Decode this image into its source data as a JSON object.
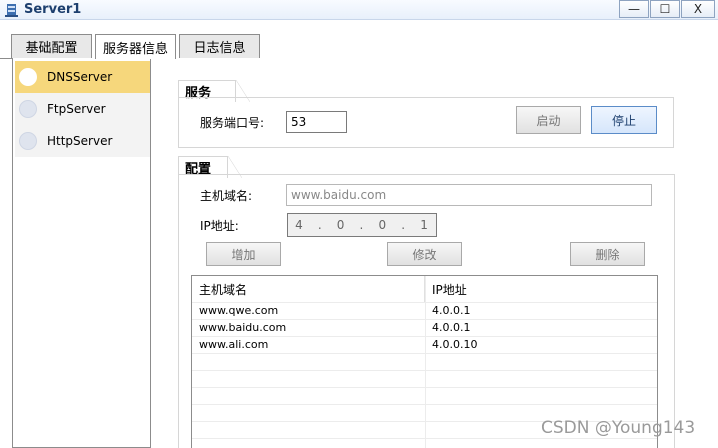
{
  "window": {
    "title": "Server1",
    "minimize_glyph": "—",
    "maximize_glyph": "☐",
    "close_glyph": "X"
  },
  "tabs": [
    {
      "label": "基础配置",
      "active": false
    },
    {
      "label": "服务器信息",
      "active": true
    },
    {
      "label": "日志信息",
      "active": false
    }
  ],
  "servers": [
    {
      "label": "DNSServer",
      "selected": true
    },
    {
      "label": "FtpServer",
      "selected": false
    },
    {
      "label": "HttpServer",
      "selected": false
    }
  ],
  "service": {
    "group_label": "服务",
    "port_label": "服务端口号:",
    "port_value": "53",
    "start_label": "启动",
    "stop_label": "停止"
  },
  "config": {
    "group_label": "配置",
    "domain_label": "主机域名:",
    "domain_placeholder": "www.baidu.com",
    "ip_label": "IP地址:",
    "ip_octets": [
      "4",
      "0",
      "0",
      "1"
    ],
    "ip_dot": ".",
    "add_label": "增加",
    "modify_label": "修改",
    "delete_label": "删除"
  },
  "table": {
    "headers": [
      "主机域名",
      "IP地址"
    ],
    "rows": [
      [
        "www.qwe.com",
        "4.0.0.1"
      ],
      [
        "www.baidu.com",
        "4.0.0.1"
      ],
      [
        "www.ali.com",
        "4.0.0.10"
      ]
    ]
  },
  "watermark": "CSDN @Young143",
  "colors": {
    "selected_item": "#f6d77c",
    "title_text": "#1d3f6e"
  }
}
